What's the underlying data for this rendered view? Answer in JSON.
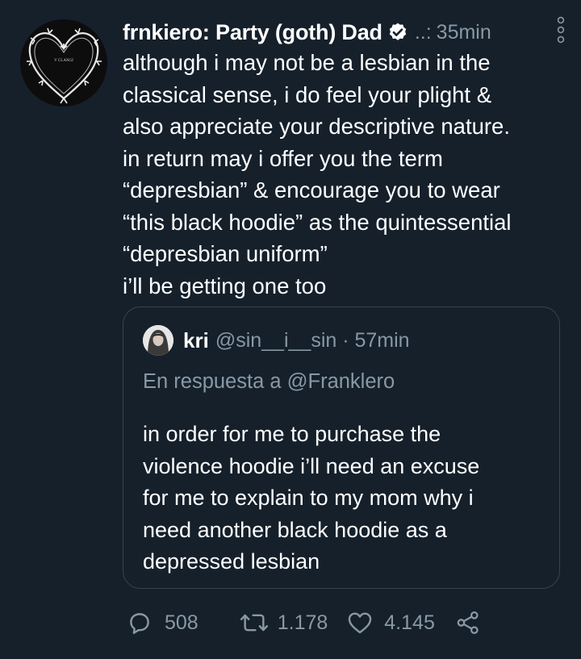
{
  "tweet": {
    "author_name": "frnkiero: Party (goth) Dad",
    "verified_icon": "verified-badge-icon",
    "handle_fragment": "..:",
    "time": "35min",
    "avatar_label": "V CLANGI",
    "body_lines": [
      "although i may not be a lesbian in the",
      "classical sense, i do feel your plight &",
      "also appreciate your descriptive nature.",
      "in return may i offer you the term",
      "“depresbian” & encourage you to wear",
      "“this black hoodie” as the quintessential",
      "“depresbian uniform”",
      "i’ll be getting one too"
    ]
  },
  "quoted": {
    "name": "kri",
    "handle_time": "@sin__i__sin · 57min",
    "reply_to": "En respuesta a @Franklero",
    "body_lines": [
      "in order for me to purchase the",
      "violence hoodie i’ll need an excuse",
      "for me to explain to my mom why i",
      "need another black hoodie as a",
      "depressed lesbian"
    ]
  },
  "actions": {
    "replies": "508",
    "retweets": "1.178",
    "likes": "4.145"
  },
  "colors": {
    "background": "#15202b",
    "secondary_text": "#8899a6",
    "border": "#38444d",
    "verified": "#ffffff"
  }
}
